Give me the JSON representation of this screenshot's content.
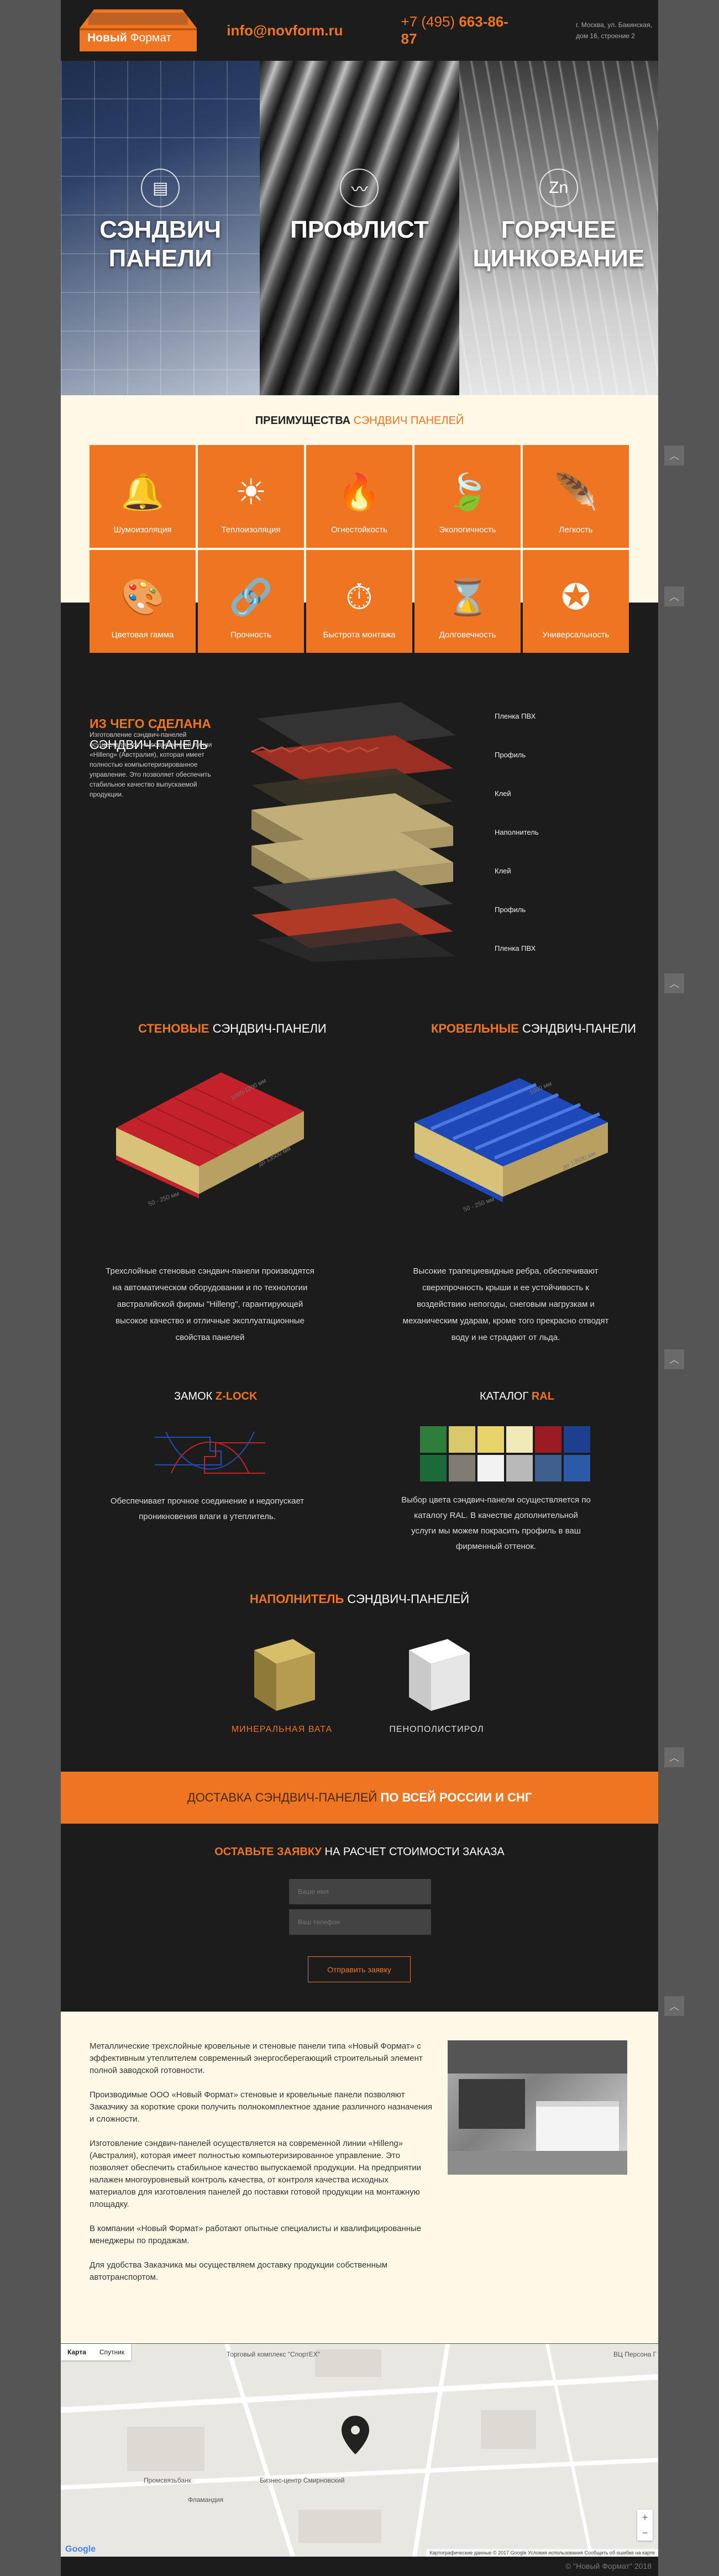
{
  "header": {
    "logo_word_1": "Новый",
    "logo_word_2": "Формат",
    "email": "info@novform.ru",
    "phone_prefix": "+7 (495)",
    "phone_number": "663-86-87",
    "address": "г. Москва, ул. Бакинская, дом 16, строение 2"
  },
  "hero": {
    "panels": [
      {
        "title": "СЭНДВИЧ ПАНЕЛИ",
        "icon": "building-icon"
      },
      {
        "title": "ПРОФЛИСТ",
        "icon": "corrugated-sheet-icon"
      },
      {
        "title": "ГОРЯЧЕЕ ЦИНКОВАНИЕ",
        "icon": "zinc-coating-icon"
      }
    ]
  },
  "advantages": {
    "title_bold": "ПРЕИМУЩЕСТВА",
    "title_accent": "СЭНДВИЧ ПАНЕЛЕЙ",
    "items": [
      {
        "label": "Шумоизоляция",
        "icon": "bell-icon",
        "glyph": "🔔"
      },
      {
        "label": "Теплоизоляция",
        "icon": "sun-icon",
        "glyph": "☀"
      },
      {
        "label": "Огнестойкость",
        "icon": "fire-icon",
        "glyph": "🔥"
      },
      {
        "label": "Экологичность",
        "icon": "leaf-icon",
        "glyph": "🍃"
      },
      {
        "label": "Легкость",
        "icon": "feather-icon",
        "glyph": "🪶"
      },
      {
        "label": "Цветовая гамма",
        "icon": "color-fan-icon",
        "glyph": "🎨"
      },
      {
        "label": "Прочность",
        "icon": "chain-link-icon",
        "glyph": "🔗"
      },
      {
        "label": "Быстрота монтажа",
        "icon": "stopwatch-icon",
        "glyph": "⏱"
      },
      {
        "label": "Долговечность",
        "icon": "hourglass-icon",
        "glyph": "⌛"
      },
      {
        "label": "Универсальность",
        "icon": "star-badge-icon",
        "glyph": "✪"
      }
    ]
  },
  "composition": {
    "title_accent": "ИЗ ЧЕГО СДЕЛАНА",
    "title_rest": "СЭНДВИЧ-ПАНЕЛЬ",
    "text": "Изготовление сэндвич-панелей осуществляется на современной линии «Hilleng» (Австралия), которая имеет полностью компьютеризированное управление. Это позволяет обеспечить стабильное качество выпускаемой продукции.",
    "layers": [
      "Пленка ПВХ",
      "Профиль",
      "Клей",
      "Наполнитель",
      "Клей",
      "Профиль",
      "Пленка ПВХ"
    ]
  },
  "panels": {
    "wall": {
      "title_accent": "СТЕНОВЫЕ",
      "title_rest": "СЭНДВИЧ-ПАНЕЛИ",
      "text": "Трехслойные стеновые сэндвич-панели производятся на автоматическом оборудовании и по технологии австралийской фирмы \"Hilleng\", гарантирующей высокое качество и отличные эксплуатационные свойства панелей",
      "dims": [
        "1000-1200 мм",
        "до 13500 мм",
        "50 - 250 мм"
      ]
    },
    "roof": {
      "title_accent": "КРОВЕЛЬНЫЕ",
      "title_rest": "СЭНДВИЧ-ПАНЕЛИ",
      "text": "Высокие трапециевидные ребра, обеспечивают сверхпрочность крыши и ее устойчивость к воздействию непогоды, снеговым нагрузкам и механическим ударам, кроме того прекрасно отводят воду и не страдают от льда.",
      "dims": [
        "1000 мм",
        "до 13500 мм",
        "50 - 250 мм"
      ]
    }
  },
  "lock": {
    "title_rest": "ЗАМОК",
    "title_accent": "Z-LOCK",
    "text": "Обеспечивает прочное соединение и недопускает проникновения влаги в утеплитель."
  },
  "ral": {
    "title_rest": "КАТАЛОГ",
    "title_accent": "RAL",
    "text": "Выбор цвета сэндвич-панели осуществляется по каталогу RAL. В качестве дополнительной услуги мы можем покрасить профиль в ваш фирменный оттенок.",
    "colors": [
      "#2e7d3a",
      "#d9c96a",
      "#e8d46b",
      "#f1e9b8",
      "#9b1b22",
      "#1d3f8f",
      "#1c6a3a",
      "#7f7a72",
      "#f2f2f2",
      "#b9b9b9",
      "#3f5f8f",
      "#2c5aa8"
    ]
  },
  "filler": {
    "title_accent": "НАПОЛНИТЕЛЬ",
    "title_rest": "СЭНДВИЧ-ПАНЕЛЕЙ",
    "items": [
      "МИНЕРАЛЬНАЯ ВАТА",
      "ПЕНОПОЛИСТИРОЛ"
    ]
  },
  "delivery": {
    "text_1": "ДОСТАВКА СЭНДВИЧ-ПАНЕЛЕЙ",
    "text_2": "ПО ВСЕЙ РОССИИ И СНГ"
  },
  "request": {
    "title_accent": "ОСТАВЬТЕ ЗАЯВКУ",
    "title_rest": "НА РАСЧЕТ СТОИМОСТИ ЗАКАЗА",
    "name_placeholder": "Ваше имя",
    "phone_placeholder": "Ваш телефон",
    "button": "Отправить заявку"
  },
  "about": {
    "paragraphs": [
      "Металлические трехслойные кровельные и стеновые панели типа «Новый Формат» с эффективным утеплителем современный энергосберегающий строительный элемент полной заводской готовности.",
      "Производимые ООО «Новый Формат» стеновые и кровельные панели позволяют Заказчику за короткие сроки получить полнокомплектное здание различного назначения и сложности.",
      "Изготовление сэндвич-панелей осуществляется на современной линии «Hilleng» (Австралия), которая имеет полностью компьютеризированное управление. Это позволяет обеспечить стабильное качество выпускаемой продукции. На предприятии налажен многоуровневый контроль качества, от контроля качества исходных материалов для изготовления панелей до поставки готовой продукции на монтажную площадку.",
      "В компании «Новый Формат» работают опытные специалисты и квалифицированные менеджеры по продажам.",
      "Для удобства Заказчика мы осуществляем доставку продукции собственным автотранспортом."
    ]
  },
  "map": {
    "tab_map": "Карта",
    "tab_satellite": "Спутник",
    "labels": [
      "Торговый комплекс \"СпортЕХ\"",
      "Бизнес-центр Смирновский",
      "Фламандия",
      "Промсвязьбанк",
      "ВЦ Персона Г"
    ],
    "google": "Google",
    "attribution": "Картографические данные © 2017 Google    Условия использования    Сообщить об ошибке на карте"
  },
  "footer": {
    "copyright": "© \"Новый Формат\" 2018"
  },
  "colors": {
    "accent": "#ee7522",
    "dark_bg": "#1c1c1c",
    "cream_bg": "#fef9e6",
    "outer_bg": "#555555"
  }
}
